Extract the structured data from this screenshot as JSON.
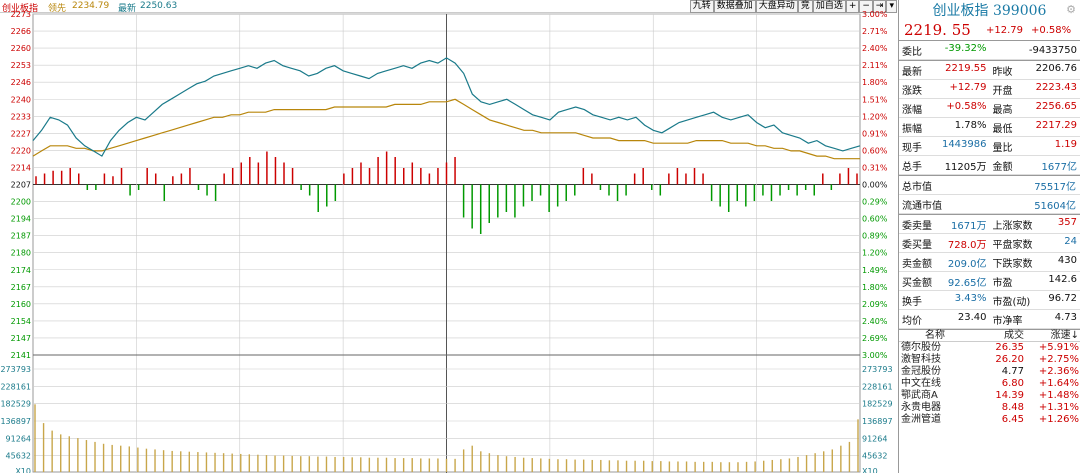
{
  "header": {
    "index_name": "创业板指",
    "lead_label": "领先",
    "lead_value": "2234.79",
    "latest_label": "最新",
    "latest_value": "2250.63"
  },
  "toolbar": {
    "buttons": [
      "九转",
      "数据叠加",
      "大盘异动",
      "竞",
      "加自选",
      "+",
      "−",
      "⇥",
      "▾"
    ]
  },
  "axes": {
    "price_ticks": [
      "2273",
      "2266",
      "2260",
      "2253",
      "2246",
      "2240",
      "2233",
      "2227",
      "2220",
      "2214",
      "2207",
      "2200",
      "2194",
      "2187",
      "2180",
      "2174",
      "2167",
      "2160",
      "2154",
      "2147",
      "2141"
    ],
    "pct_ticks": [
      "3.00%",
      "2.71%",
      "2.40%",
      "2.11%",
      "1.80%",
      "1.51%",
      "1.20%",
      "0.91%",
      "0.60%",
      "0.31%",
      "0.00%",
      "0.29%",
      "0.60%",
      "0.89%",
      "1.20%",
      "1.49%",
      "1.80%",
      "2.09%",
      "2.40%",
      "2.69%",
      "3.00%"
    ],
    "vol_ticks": [
      "273793",
      "228161",
      "182529",
      "136897",
      "91264",
      "45632",
      "X10"
    ]
  },
  "colors": {
    "up": "#cc0000",
    "down": "#009900",
    "price_line": "#1a7a8a",
    "avg_line": "#b8860b",
    "grid": "#cccccc"
  },
  "chart_data": {
    "type": "line",
    "prev_close": 2206.76,
    "ylim": [
      2141,
      2273
    ],
    "price_series": [
      2224,
      2228,
      2233,
      2232,
      2230,
      2225,
      2222,
      2220,
      2218,
      2224,
      2228,
      2231,
      2233,
      2232,
      2235,
      2238,
      2240,
      2242,
      2244,
      2246,
      2247,
      2249,
      2250,
      2251,
      2252,
      2253,
      2252,
      2254,
      2255,
      2253,
      2252,
      2251,
      2249,
      2250,
      2252,
      2253,
      2251,
      2250,
      2249,
      2248,
      2250,
      2251,
      2252,
      2253,
      2252,
      2254,
      2255,
      2254,
      2256,
      2254,
      2250,
      2242,
      2239,
      2238,
      2239,
      2240,
      2238,
      2236,
      2234,
      2233,
      2232,
      2235,
      2236,
      2237,
      2236,
      2234,
      2233,
      2232,
      2233,
      2232,
      2233,
      2230,
      2228,
      2227,
      2229,
      2231,
      2232,
      2233,
      2234,
      2235,
      2233,
      2232,
      2233,
      2234,
      2231,
      2229,
      2230,
      2227,
      2226,
      2225,
      2223,
      2224,
      2222,
      2221,
      2220,
      2221,
      2222
    ],
    "avg_series": [
      2218,
      2220,
      2222,
      2222,
      2222,
      2221,
      2221,
      2220,
      2220,
      2221,
      2222,
      2223,
      2224,
      2225,
      2226,
      2227,
      2228,
      2229,
      2230,
      2231,
      2232,
      2233,
      2233,
      2234,
      2234,
      2235,
      2235,
      2235,
      2236,
      2236,
      2236,
      2236,
      2236,
      2236,
      2236,
      2237,
      2237,
      2237,
      2237,
      2237,
      2237,
      2237,
      2238,
      2238,
      2238,
      2238,
      2239,
      2239,
      2239,
      2240,
      2238,
      2236,
      2234,
      2232,
      2231,
      2230,
      2229,
      2228,
      2228,
      2227,
      2227,
      2227,
      2227,
      2227,
      2226,
      2225,
      2225,
      2225,
      2224,
      2224,
      2224,
      2224,
      2223,
      2223,
      2223,
      2223,
      2223,
      2224,
      2224,
      2224,
      2224,
      2223,
      2223,
      2223,
      2222,
      2222,
      2221,
      2221,
      2220,
      2220,
      2219,
      2218,
      2218,
      2217,
      2217,
      2217,
      2217
    ],
    "minute_bars": [
      1.5,
      2,
      2.5,
      2.5,
      3,
      2,
      -1,
      -1,
      2,
      1.5,
      3,
      -2,
      -1,
      3,
      2,
      -3,
      1.5,
      2,
      3,
      -1,
      -2,
      -3,
      2,
      3,
      4,
      5,
      4,
      6,
      5,
      4,
      3,
      -1,
      -2,
      -5,
      -4,
      -3,
      2,
      3,
      4,
      3,
      5,
      6,
      5,
      3,
      4,
      3,
      2,
      3,
      4,
      5,
      -6,
      -8,
      -9,
      -7,
      -6,
      -5,
      -6,
      -4,
      -3,
      -2,
      -5,
      -4,
      -3,
      -2,
      3,
      2,
      -1,
      -2,
      -3,
      -2,
      2,
      3,
      -1,
      -2,
      2,
      3,
      2,
      3,
      2,
      -3,
      -4,
      -5,
      -3,
      -4,
      -3,
      -2,
      -3,
      -2,
      -1,
      -2,
      -1,
      -2,
      2,
      -1,
      2,
      3,
      2
    ],
    "volume_series": [
      180000,
      130000,
      110000,
      100000,
      95000,
      90000,
      85000,
      80000,
      75000,
      72000,
      70000,
      68000,
      65000,
      62000,
      60000,
      58000,
      56000,
      55000,
      54000,
      53000,
      52000,
      51000,
      50000,
      49000,
      48000,
      47000,
      46000,
      45000,
      44000,
      44000,
      43000,
      42000,
      42000,
      41000,
      41000,
      40000,
      40000,
      39000,
      39000,
      38000,
      38000,
      38000,
      37000,
      37000,
      37000,
      36000,
      36000,
      36000,
      35000,
      35000,
      60000,
      70000,
      55000,
      50000,
      45000,
      42000,
      40000,
      38000,
      37000,
      36000,
      35000,
      34000,
      34000,
      33000,
      33000,
      32000,
      32000,
      31000,
      31000,
      30000,
      30000,
      30000,
      29000,
      29000,
      28000,
      28000,
      28000,
      27000,
      27000,
      27000,
      26000,
      26000,
      26000,
      27000,
      28000,
      30000,
      32000,
      34000,
      36000,
      40000,
      45000,
      50000,
      55000,
      60000,
      70000,
      80000,
      140000
    ]
  },
  "panel": {
    "title": "创业板指 399006",
    "price": "2219. 55",
    "change": "+12.79",
    "change_pct": "+0.58%",
    "rows1": [
      [
        {
          "k": "委比",
          "v": "-39.32%",
          "c": "green"
        },
        {
          "k": "",
          "v": "-9433750",
          "c": "blk"
        }
      ]
    ],
    "rows2": [
      [
        {
          "k": "最新",
          "v": "2219.55",
          "c": "red"
        },
        {
          "k": "昨收",
          "v": "2206.76",
          "c": "blk"
        }
      ],
      [
        {
          "k": "涨跌",
          "v": "+12.79",
          "c": "red"
        },
        {
          "k": "开盘",
          "v": "2223.43",
          "c": "red"
        }
      ],
      [
        {
          "k": "涨幅",
          "v": "+0.58%",
          "c": "red"
        },
        {
          "k": "最高",
          "v": "2256.65",
          "c": "red"
        }
      ],
      [
        {
          "k": "振幅",
          "v": "1.78%",
          "c": "blk"
        },
        {
          "k": "最低",
          "v": "2217.29",
          "c": "red"
        }
      ],
      [
        {
          "k": "现手",
          "v": "1443986",
          "c": "blue"
        },
        {
          "k": "量比",
          "v": "1.19",
          "c": "red"
        }
      ],
      [
        {
          "k": "总手",
          "v": "11205万",
          "c": "blk"
        },
        {
          "k": "金额",
          "v": "1677亿",
          "c": "blue"
        }
      ]
    ],
    "rows3": [
      [
        {
          "k": "总市值",
          "v": "75517亿",
          "c": "blue"
        }
      ],
      [
        {
          "k": "流通市值",
          "v": "51604亿",
          "c": "blue"
        }
      ]
    ],
    "rows4": [
      [
        {
          "k": "委卖量",
          "v": "1671万",
          "c": "blue"
        },
        {
          "k": "上涨家数",
          "v": "357",
          "c": "red"
        }
      ],
      [
        {
          "k": "委买量",
          "v": "728.0万",
          "c": "red"
        },
        {
          "k": "平盘家数",
          "v": "24",
          "c": "blue"
        }
      ],
      [
        {
          "k": "卖金额",
          "v": "209.0亿",
          "c": "blue"
        },
        {
          "k": "下跌家数",
          "v": "430",
          "c": "blk"
        }
      ],
      [
        {
          "k": "买金额",
          "v": "92.65亿",
          "c": "blue"
        },
        {
          "k": "市盈",
          "v": "142.6",
          "c": "blk"
        }
      ],
      [
        {
          "k": "换手",
          "v": "3.43%",
          "c": "blue"
        },
        {
          "k": "市盈(动)",
          "v": "96.72",
          "c": "blk"
        }
      ],
      [
        {
          "k": "均价",
          "v": "23.40",
          "c": "blk"
        },
        {
          "k": "市净率",
          "v": "4.73",
          "c": "blk"
        }
      ]
    ],
    "stock_header": [
      "名称",
      "成交",
      "涨速↓"
    ],
    "stocks": [
      [
        "德尔股份",
        "26.35",
        "+5.91%"
      ],
      [
        "激智科技",
        "26.20",
        "+2.75%"
      ],
      [
        "金冠股份",
        "4.77",
        "+2.36%"
      ],
      [
        "中文在线",
        "6.80",
        "+1.64%"
      ],
      [
        "鄂武商A",
        "14.39",
        "+1.48%"
      ],
      [
        "永贵电器",
        "8.48",
        "+1.31%"
      ],
      [
        "金洲管道",
        "6.45",
        "+1.26%"
      ]
    ]
  }
}
